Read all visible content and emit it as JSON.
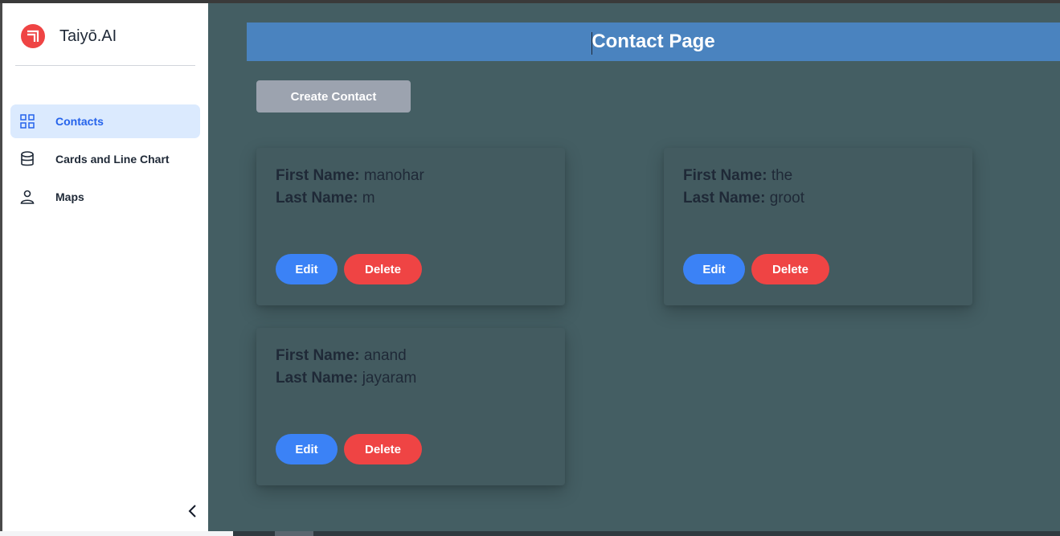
{
  "brand": {
    "name": "Taiyō.AI",
    "logo_icon": "taiyo-logo-icon",
    "accent": "#ef4444"
  },
  "sidebar": {
    "items": [
      {
        "label": "Contacts",
        "icon": "grid-icon",
        "active": true
      },
      {
        "label": "Cards and Line Chart",
        "icon": "database-icon",
        "active": false
      },
      {
        "label": "Maps",
        "icon": "user-icon",
        "active": false
      }
    ],
    "collapse_icon": "chevron-left-icon"
  },
  "header": {
    "title": "Contact Page",
    "color": "#4a83bf"
  },
  "actions": {
    "create_label": "Create Contact"
  },
  "labels": {
    "first_name": "First Name:",
    "last_name": "Last Name:",
    "edit": "Edit",
    "delete": "Delete"
  },
  "contacts": [
    {
      "first_name": "manohar",
      "last_name": "m"
    },
    {
      "first_name": "the",
      "last_name": "groot"
    },
    {
      "first_name": "anand",
      "last_name": "jayaram"
    }
  ],
  "colors": {
    "edit": "#3b82f6",
    "delete": "#ef4444",
    "main_bg": "#445e63",
    "active_nav": "#dbeafe"
  }
}
